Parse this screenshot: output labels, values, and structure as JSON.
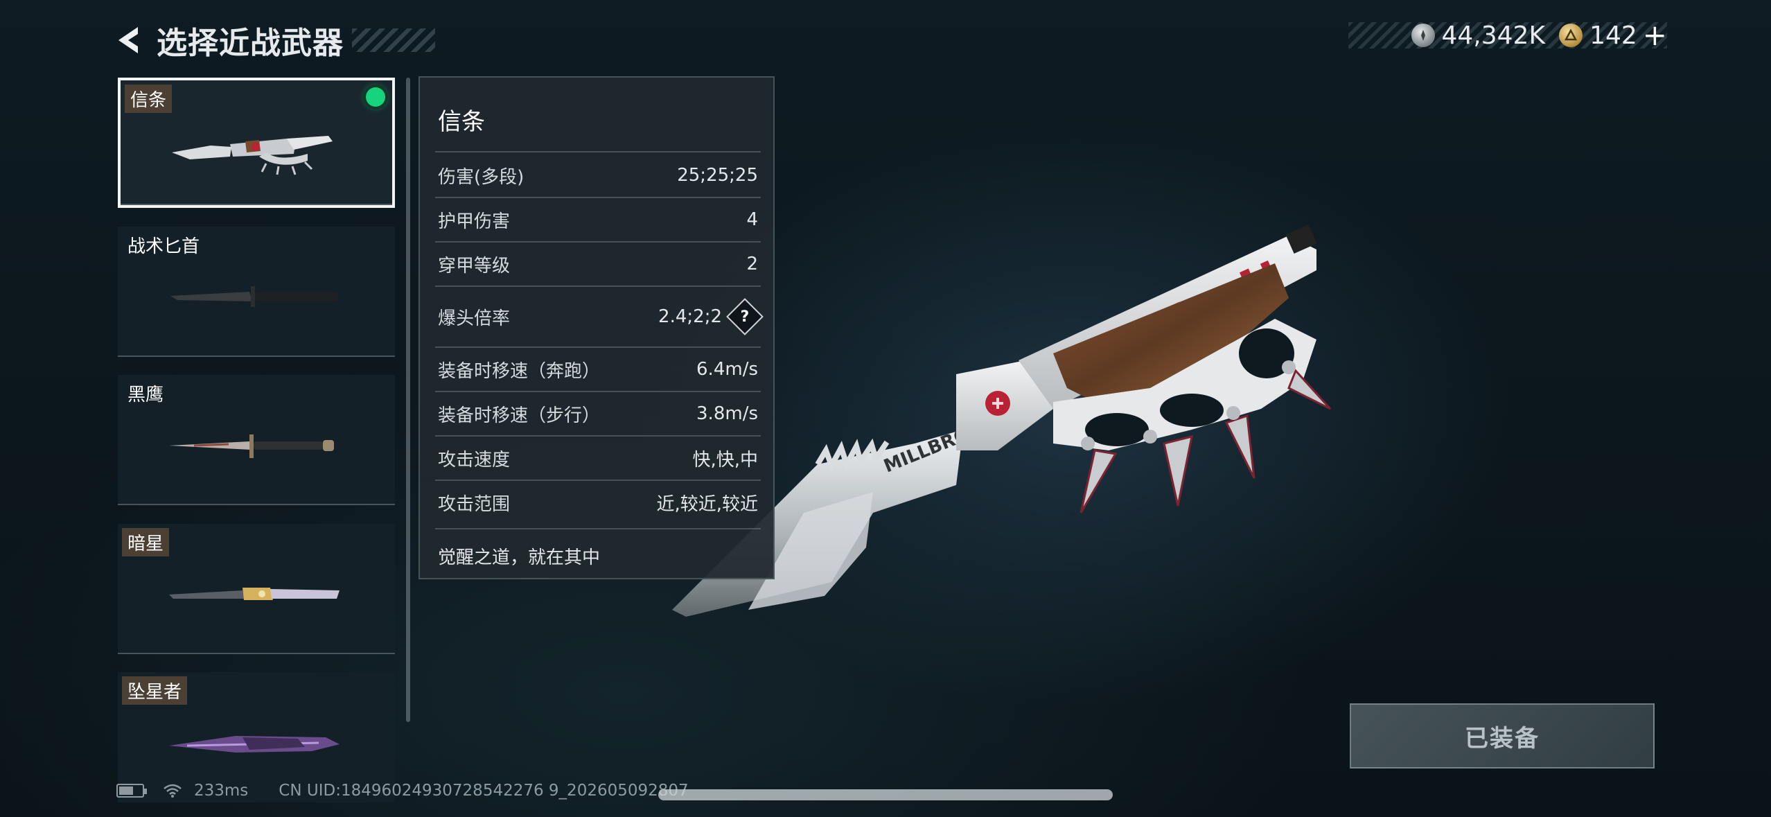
{
  "header": {
    "title": "选择近战武器",
    "back_icon": "back-arrow-icon"
  },
  "currency": [
    {
      "icon": "silver-coin-icon",
      "value": "44,342K"
    },
    {
      "icon": "gold-coin-icon",
      "value": "142"
    }
  ],
  "currency_add": "+",
  "weapons": [
    {
      "name": "信条",
      "selected": true,
      "equipped": true,
      "tagged": true
    },
    {
      "name": "战术匕首",
      "selected": false,
      "equipped": false,
      "tagged": false
    },
    {
      "name": "黑鹰",
      "selected": false,
      "equipped": false,
      "tagged": false
    },
    {
      "name": "暗星",
      "selected": false,
      "equipped": false,
      "tagged": true
    },
    {
      "name": "坠星者",
      "selected": false,
      "equipped": false,
      "tagged": true
    }
  ],
  "stats": {
    "title": "信条",
    "rows": [
      {
        "label": "伤害(多段)",
        "value": "25;25;25"
      },
      {
        "label": "护甲伤害",
        "value": "4"
      },
      {
        "label": "穿甲等级",
        "value": "2"
      },
      {
        "label": "爆头倍率",
        "value": "2.4;2;2",
        "help": "?"
      },
      {
        "label": "装备时移速（奔跑）",
        "value": "6.4m/s"
      },
      {
        "label": "装备时移速（步行）",
        "value": "3.8m/s"
      },
      {
        "label": "攻击速度",
        "value": "快,快,中"
      },
      {
        "label": "攻击范围",
        "value": "近,较近,较近"
      }
    ],
    "description": "觉醒之道，就在其中"
  },
  "equip_button": "已装备",
  "status": {
    "ping": "233ms",
    "uid": "CN UID:18496024930728542276 9_202605092807"
  },
  "colors": {
    "equipped_dot": "#16d37e",
    "background": "#0e1b22",
    "panel": "#20292e"
  }
}
